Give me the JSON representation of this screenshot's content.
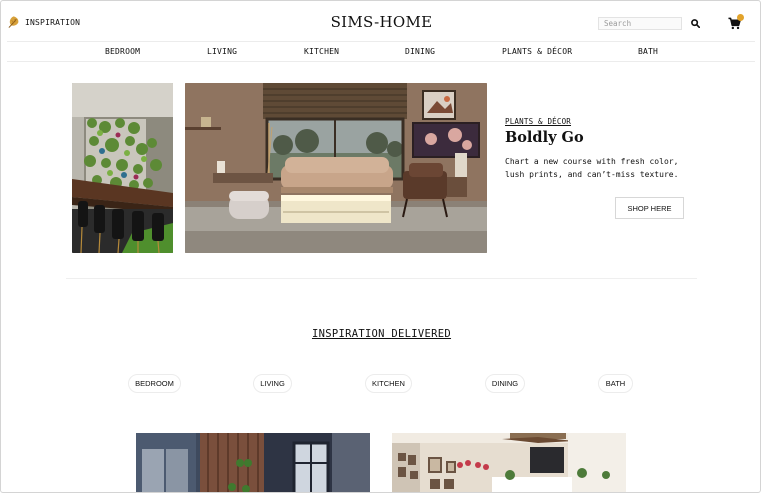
{
  "header": {
    "inspiration_label": "INSPIRATION",
    "logo": "SIMS-HOME",
    "search_placeholder": "Search",
    "cart_count": "",
    "icons": {
      "inspiration": "leaf-icon",
      "search": "search-icon",
      "cart": "cart-icon"
    },
    "accent_color": "#e2a32b"
  },
  "categories": [
    "BEDROOM",
    "LIVING",
    "KITCHEN",
    "DINING",
    "PLANTS & DÉCOR",
    "BATH"
  ],
  "hero": {
    "kicker": "PLANTS & DÉCOR",
    "title": "Boldly Go",
    "body": "Chart a new course with fresh color, lush prints, and can’t-miss texture.",
    "cta": "SHOP HERE"
  },
  "inspiration": {
    "title": "INSPIRATION DELIVERED",
    "filters": [
      "BEDROOM",
      "LIVING",
      "KITCHEN",
      "DINING",
      "BATH"
    ]
  }
}
